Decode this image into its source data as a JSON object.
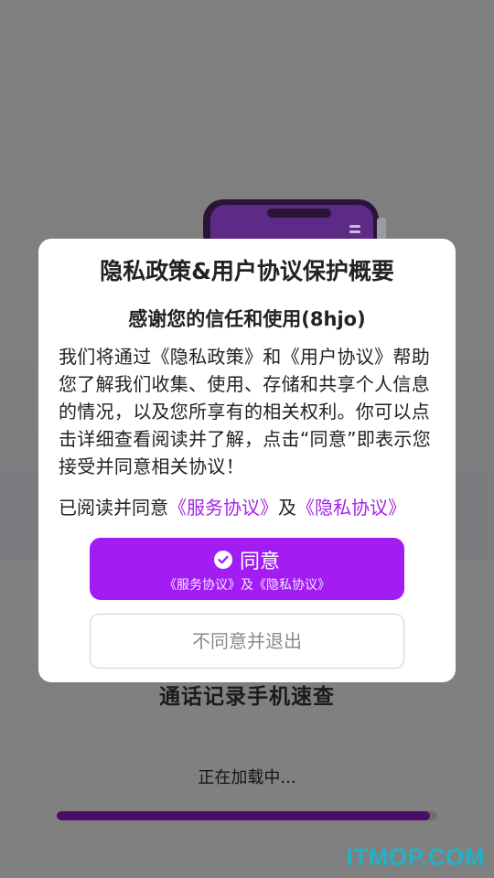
{
  "splash": {
    "app_name": "通话记录手机速查",
    "loading_text": "正在加载中...",
    "progress": 0.98,
    "watermark": "ITMOP.COM"
  },
  "dialog": {
    "title": "隐私政策&用户协议保护概要",
    "subtitle": "感谢您的信任和使用(8hjo)",
    "body": "我们将通过《隐私政策》和《用户协议》帮助您了解我们收集、使用、存储和共享个人信息的情况，以及您所享有的相关权利。你可以点击详细查看阅读并了解，点击“同意”即表示您接受并同意相关协议！",
    "agree_prefix": "已阅读并同意",
    "service_link": "《服务协议》",
    "conjunction": "及",
    "privacy_link": "《隐私协议》",
    "agree_button_label": "同意",
    "agree_button_sub": "《服务协议》及《隐私协议》",
    "disagree_button_label": "不同意并退出"
  },
  "colors": {
    "accent": "#a21cf3",
    "link": "#a225e6",
    "progress": "#4a0d68",
    "watermark": "#1fb3c8"
  },
  "icons": {
    "agree_check": "check-circle-icon",
    "illustration": "phone-illustration"
  }
}
